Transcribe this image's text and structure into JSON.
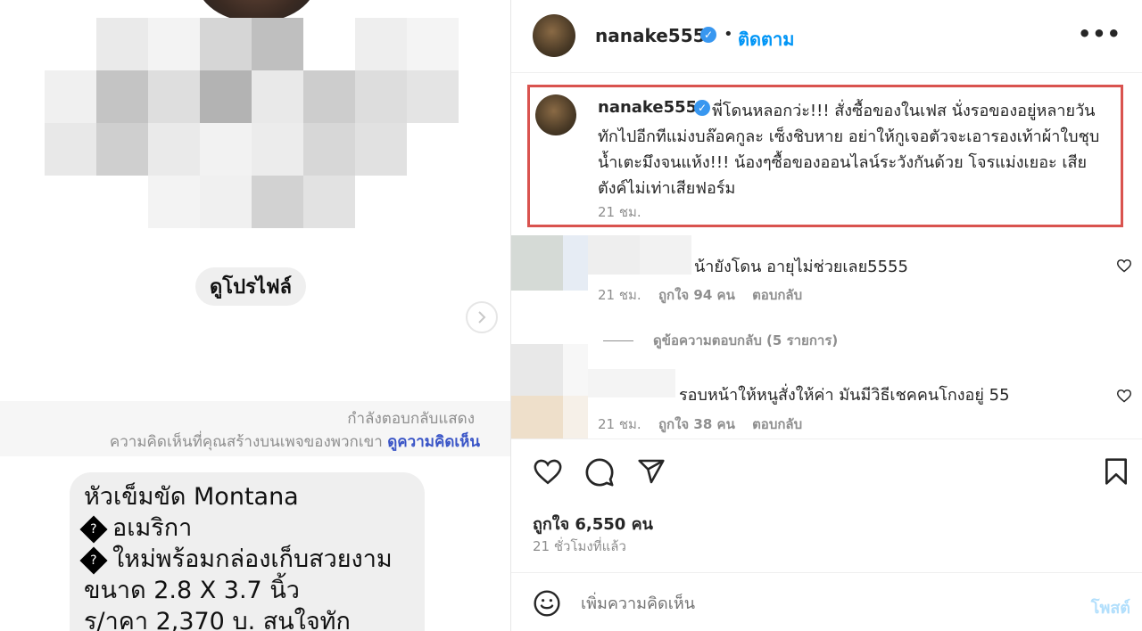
{
  "left": {
    "profile_button": "ดูโปรไฟล์",
    "reply_notice_line1": "กำลังตอบกลับแสดง",
    "reply_notice_line2": "ความคิดเห็นที่คุณสร้างบนเพจของพวกเขา",
    "reply_notice_link": "ดูความคิดเห็น",
    "message_lines": [
      "หัวเข็มขัด Montana",
      "อเมริกา",
      "ใหม่พร้อมกล่องเก็บสวยงาม",
      "ขนาด 2.8 X 3.7 นิ้ว",
      "ร/าคา 2,370 บ. สนใจทัก"
    ],
    "message_bullet_glyph": "?"
  },
  "post": {
    "username": "nanake555",
    "verified_glyph": "✓",
    "separator": "•",
    "follow_label": "ติดตาม",
    "more_label": "•••",
    "caption": {
      "username": "nanake555",
      "text": "พี่โดนหลอกว่ะ!!! สั่งซื้อของในเฟส นั่งรอของอยู่หลายวัน ทักไปอีกทีแม่งบล๊อคกูละ เซ็งชิบหาย อย่าให้กูเจอตัวจะเอารองเท้าผ้าใบชุบน้ำเตะมึงจนแห้ง!!! น้องๆซื้อของออนไลน์ระวังกันด้วย โจรแม่งเยอะ เสียตังค์ไม่เท่าเสียฟอร์ม",
      "time": "21 ชม."
    },
    "comments": [
      {
        "text": "น้ายังโดน อายุไม่ช่วยเลย5555",
        "time": "21 ชม.",
        "likes": "ถูกใจ 94 คน",
        "reply": "ตอบกลับ"
      },
      {
        "text": "รอบหน้าให้หนูสั่งให้ค่า มันมีวิธีเชคคนโกงอยู่ 55",
        "time": "21 ชม.",
        "likes": "ถูกใจ 38 คน",
        "reply": "ตอบกลับ"
      }
    ],
    "view_replies": "ดูข้อความตอบกลับ (5 รายการ)",
    "likes_total": "ถูกใจ 6,550 คน",
    "posted_ago": "21 ชั่วโมงที่แล้ว",
    "add_comment_placeholder": "เพิ่มความคิดเห็น",
    "post_label": "โพสต์"
  },
  "icons": {
    "heart": "heart-icon",
    "comment": "comment-icon",
    "share": "share-icon",
    "save": "bookmark-icon",
    "emoji": "emoji-icon",
    "next": "chevron-right-icon"
  },
  "colors": {
    "link": "#0095f6",
    "verified": "#3897f0",
    "highlight_border": "#d9534f",
    "reply_link": "#3a55c7"
  }
}
